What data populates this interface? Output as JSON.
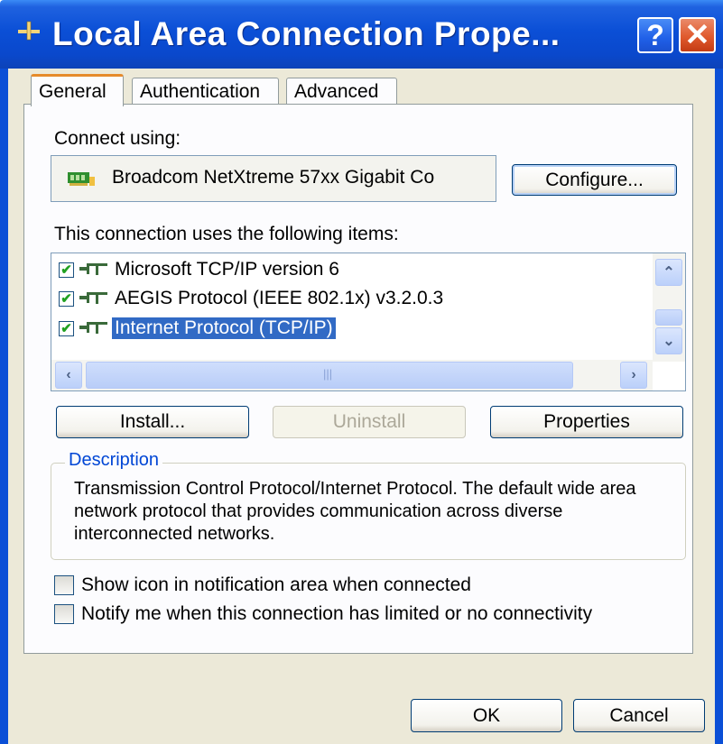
{
  "window": {
    "title": "Local Area Connection Prope...",
    "help_label": "?",
    "close_label": "✕"
  },
  "tabs": [
    {
      "label": "General",
      "active": true
    },
    {
      "label": "Authentication",
      "active": false
    },
    {
      "label": "Advanced",
      "active": false
    }
  ],
  "general": {
    "connect_using_label": "Connect using:",
    "adapter_name": "Broadcom NetXtreme 57xx Gigabit Co",
    "configure_label": "Configure...",
    "items_label": "This connection uses the following items:",
    "items": [
      {
        "label": "Microsoft TCP/IP version 6",
        "checked": true,
        "selected": false
      },
      {
        "label": "AEGIS Protocol (IEEE 802.1x) v3.2.0.3",
        "checked": true,
        "selected": false
      },
      {
        "label": "Internet Protocol (TCP/IP)",
        "checked": true,
        "selected": true
      }
    ],
    "install_label": "Install...",
    "uninstall_label": "Uninstall",
    "properties_label": "Properties",
    "description_title": "Description",
    "description_text": "Transmission Control Protocol/Internet Protocol. The default wide area network protocol that provides communication across diverse interconnected networks.",
    "show_icon_label": "Show icon in notification area when connected",
    "notify_label": "Notify me when this connection has limited or no connectivity"
  },
  "footer": {
    "ok_label": "OK",
    "cancel_label": "Cancel"
  },
  "colors": {
    "titlebar": "#0b4fd6",
    "selection": "#316ac5",
    "active_tab_accent": "#e68b2c",
    "description_title": "#0046d5"
  }
}
